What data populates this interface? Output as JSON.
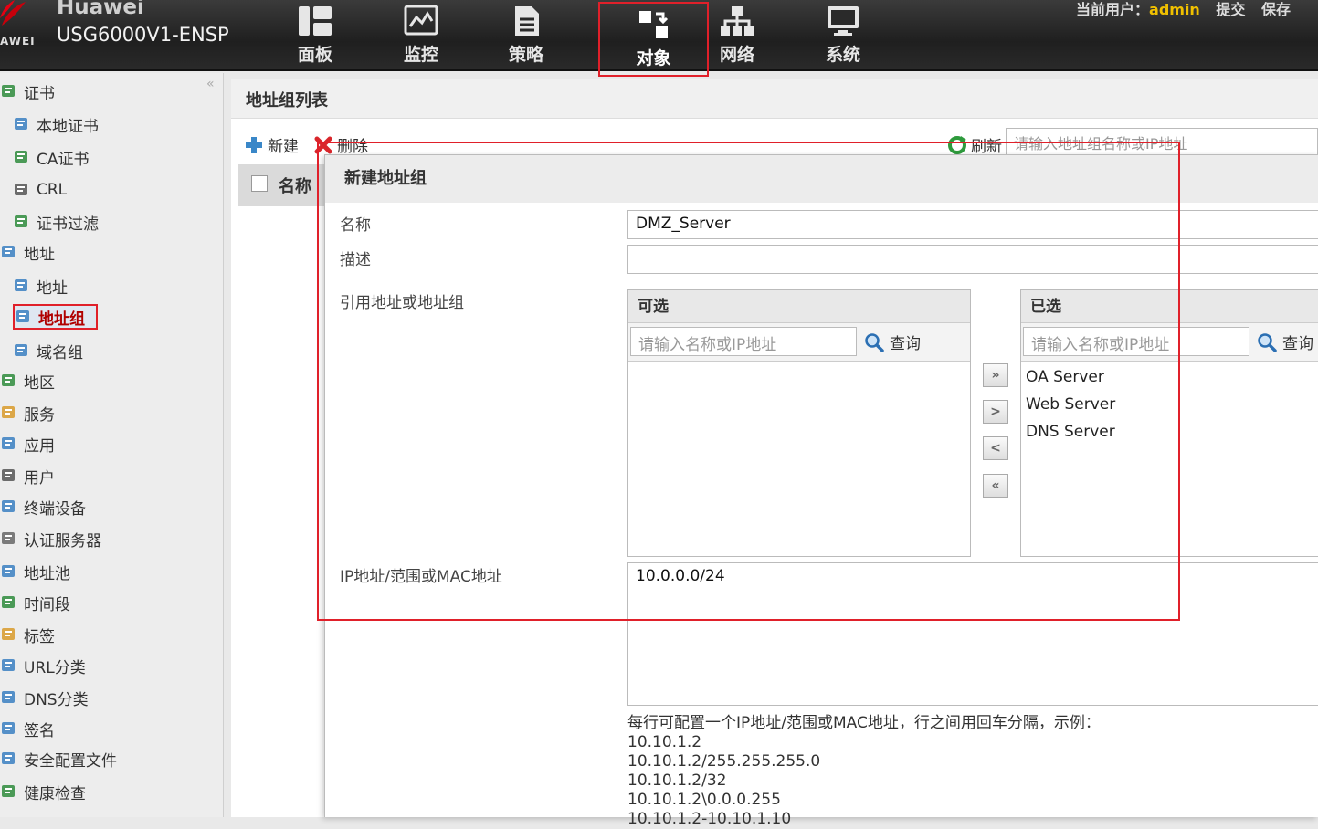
{
  "header": {
    "brand_name": "Huawei",
    "brand_sub": "AWEI",
    "model": "USG6000V1-ENSP",
    "nav": [
      {
        "label": "面板",
        "icon": "dashboard-icon"
      },
      {
        "label": "监控",
        "icon": "monitor-icon"
      },
      {
        "label": "策略",
        "icon": "policy-document-icon"
      },
      {
        "label": "对象",
        "icon": "objects-icon",
        "active": true
      },
      {
        "label": "网络",
        "icon": "network-icon"
      },
      {
        "label": "系统",
        "icon": "system-icon"
      }
    ],
    "current_user_label": "当前用户：",
    "current_user": "admin",
    "submit_label": "提交",
    "save_label": "保存"
  },
  "sidebar": {
    "collapse": "«",
    "items": [
      {
        "label": "证书",
        "icon": "certificate-icon"
      },
      {
        "label": "本地证书",
        "icon": "local-cert-icon"
      },
      {
        "label": "CA证书",
        "icon": "ca-cert-icon"
      },
      {
        "label": "CRL",
        "icon": "crl-icon"
      },
      {
        "label": "证书过滤",
        "icon": "cert-filter-icon"
      },
      {
        "label": "地址",
        "icon": "address-icon"
      },
      {
        "label": "地址",
        "icon": "address-icon"
      },
      {
        "label": "地址组",
        "icon": "address-group-icon",
        "selected": true
      },
      {
        "label": "域名组",
        "icon": "domain-group-icon"
      },
      {
        "label": "地区",
        "icon": "region-icon"
      },
      {
        "label": "服务",
        "icon": "service-icon"
      },
      {
        "label": "应用",
        "icon": "application-icon"
      },
      {
        "label": "用户",
        "icon": "user-icon"
      },
      {
        "label": "终端设备",
        "icon": "terminal-icon"
      },
      {
        "label": "认证服务器",
        "icon": "auth-server-icon"
      },
      {
        "label": "地址池",
        "icon": "address-pool-icon"
      },
      {
        "label": "时间段",
        "icon": "time-range-icon"
      },
      {
        "label": "标签",
        "icon": "tag-icon"
      },
      {
        "label": "URL分类",
        "icon": "url-category-icon"
      },
      {
        "label": "DNS分类",
        "icon": "dns-category-icon"
      },
      {
        "label": "签名",
        "icon": "signature-icon"
      },
      {
        "label": "安全配置文件",
        "icon": "security-profile-icon"
      },
      {
        "label": "健康检查",
        "icon": "health-check-icon"
      }
    ]
  },
  "main": {
    "title": "地址组列表",
    "new_label": "新建",
    "delete_label": "删除",
    "refresh_label": "刷新",
    "search_placeholder": "请输入地址组名称或IP地址",
    "list_header_name": "名称"
  },
  "dialog": {
    "title": "新建地址组",
    "name_label": "名称",
    "name_value": "DMZ_Server",
    "desc_label": "描述",
    "desc_value": "",
    "ref_label": "引用地址或地址组",
    "available": {
      "title": "可选",
      "search_placeholder": "请输入名称或IP地址",
      "query_label": "查询",
      "items": []
    },
    "selected": {
      "title": "已选",
      "search_placeholder": "请输入名称或IP地址",
      "query_label": "查询",
      "items": [
        "OA Server",
        "Web Server",
        "DNS Server"
      ]
    },
    "move_buttons": [
      "»",
      ">",
      "<",
      "«"
    ],
    "ip_label": "IP地址/范围或MAC地址",
    "ip_value": "10.0.0.0/24",
    "hint_lines": [
      "每行可配置一个IP地址/范围或MAC地址，行之间用回车分隔，示例：",
      "10.10.1.2",
      "10.10.1.2/255.255.255.0",
      "10.10.1.2/32",
      "10.10.1.2\\0.0.0.255",
      "10.10.1.2-10.10.1.10"
    ]
  },
  "colors": {
    "highlight": "#e0202a",
    "user_name": "#f0c000"
  }
}
